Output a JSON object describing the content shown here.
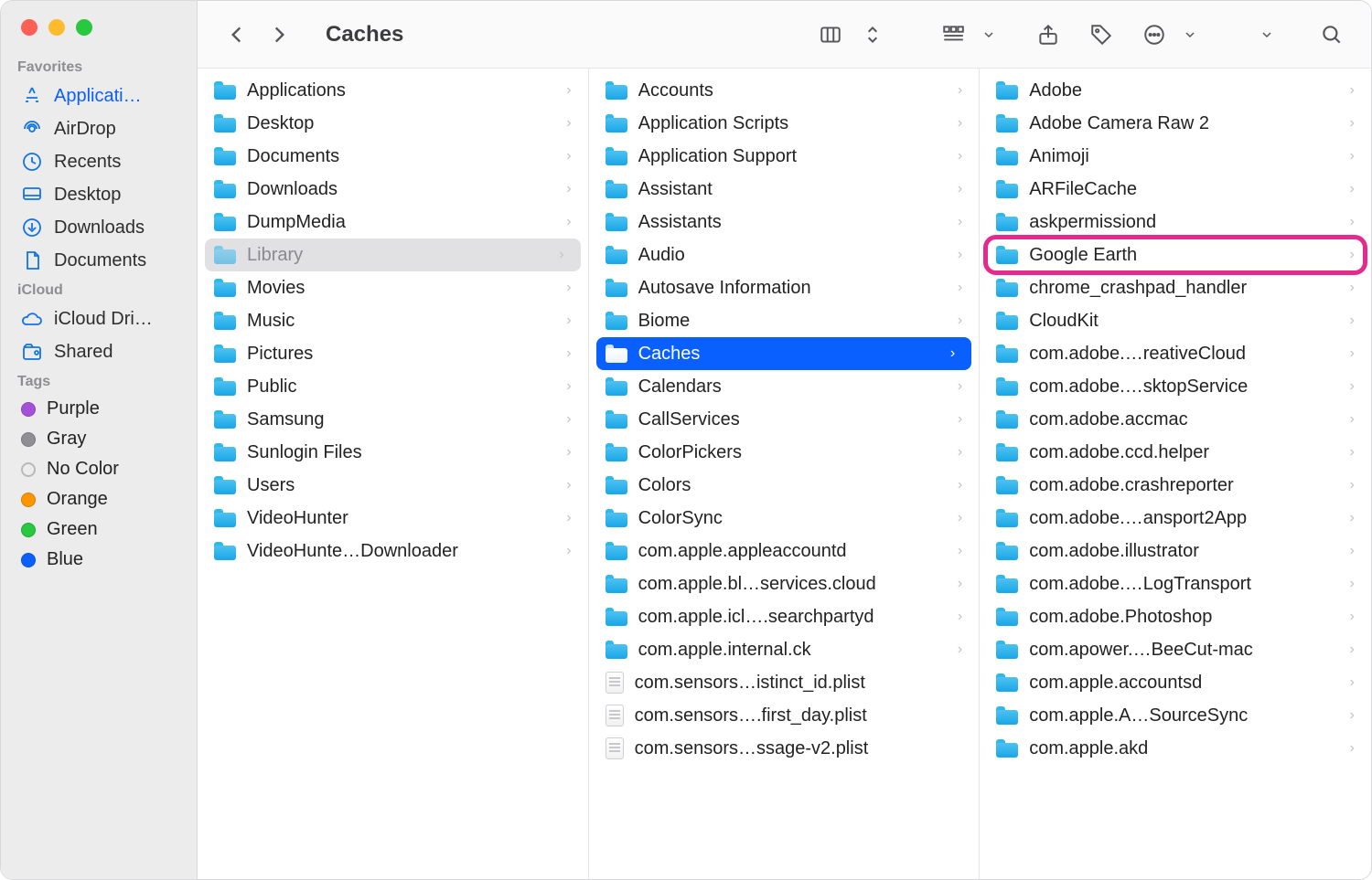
{
  "window_title": "Caches",
  "sidebar": {
    "sections": [
      {
        "heading": "Favorites",
        "items": [
          {
            "icon": "app-store-icon",
            "label": "Applicati…",
            "active": true
          },
          {
            "icon": "airdrop-icon",
            "label": "AirDrop"
          },
          {
            "icon": "recents-icon",
            "label": "Recents"
          },
          {
            "icon": "desktop-icon",
            "label": "Desktop"
          },
          {
            "icon": "downloads-icon",
            "label": "Downloads"
          },
          {
            "icon": "documents-icon",
            "label": "Documents"
          }
        ]
      },
      {
        "heading": "iCloud",
        "items": [
          {
            "icon": "cloud-icon",
            "label": "iCloud Dri…"
          },
          {
            "icon": "shared-icon",
            "label": "Shared"
          }
        ]
      },
      {
        "heading": "Tags",
        "tags": [
          {
            "color": "#a450d8",
            "label": "Purple"
          },
          {
            "color": "#8e8e93",
            "label": "Gray"
          },
          {
            "color": "transparent",
            "label": "No Color",
            "hollow": true
          },
          {
            "color": "#ff9500",
            "label": "Orange"
          },
          {
            "color": "#28c840",
            "label": "Green"
          },
          {
            "color": "#0a60ff",
            "label": "Blue"
          }
        ]
      }
    ]
  },
  "columns": [
    {
      "items": [
        {
          "type": "folder",
          "name": "Applications"
        },
        {
          "type": "folder",
          "name": "Desktop"
        },
        {
          "type": "folder",
          "name": "Documents"
        },
        {
          "type": "folder",
          "name": "Downloads"
        },
        {
          "type": "folder",
          "name": "DumpMedia"
        },
        {
          "type": "folder",
          "name": "Library",
          "selected": "gray"
        },
        {
          "type": "folder",
          "name": "Movies"
        },
        {
          "type": "folder",
          "name": "Music"
        },
        {
          "type": "folder",
          "name": "Pictures"
        },
        {
          "type": "folder",
          "name": "Public"
        },
        {
          "type": "folder",
          "name": "Samsung"
        },
        {
          "type": "folder",
          "name": "Sunlogin Files"
        },
        {
          "type": "folder",
          "name": "Users"
        },
        {
          "type": "folder",
          "name": "VideoHunter"
        },
        {
          "type": "folder",
          "name": "VideoHunte…Downloader"
        }
      ]
    },
    {
      "items": [
        {
          "type": "folder",
          "name": "Accounts"
        },
        {
          "type": "folder",
          "name": "Application Scripts"
        },
        {
          "type": "folder",
          "name": "Application Support"
        },
        {
          "type": "folder",
          "name": "Assistant"
        },
        {
          "type": "folder",
          "name": "Assistants"
        },
        {
          "type": "folder",
          "name": "Audio"
        },
        {
          "type": "folder",
          "name": "Autosave Information"
        },
        {
          "type": "folder",
          "name": "Biome"
        },
        {
          "type": "folder",
          "name": "Caches",
          "selected": "blue"
        },
        {
          "type": "folder",
          "name": "Calendars"
        },
        {
          "type": "folder",
          "name": "CallServices"
        },
        {
          "type": "folder",
          "name": "ColorPickers"
        },
        {
          "type": "folder",
          "name": "Colors"
        },
        {
          "type": "folder",
          "name": "ColorSync"
        },
        {
          "type": "folder",
          "name": "com.apple.appleaccountd"
        },
        {
          "type": "folder",
          "name": "com.apple.bl…services.cloud"
        },
        {
          "type": "folder",
          "name": "com.apple.icl….searchpartyd"
        },
        {
          "type": "folder",
          "name": "com.apple.internal.ck"
        },
        {
          "type": "file",
          "name": "com.sensors…istinct_id.plist"
        },
        {
          "type": "file",
          "name": "com.sensors….first_day.plist"
        },
        {
          "type": "file",
          "name": "com.sensors…ssage-v2.plist"
        }
      ]
    },
    {
      "items": [
        {
          "type": "folder",
          "name": "Adobe"
        },
        {
          "type": "folder",
          "name": "Adobe Camera Raw 2"
        },
        {
          "type": "folder",
          "name": "Animoji"
        },
        {
          "type": "folder",
          "name": "ARFileCache"
        },
        {
          "type": "folder",
          "name": "askpermissiond"
        },
        {
          "type": "folder",
          "name": "Google Earth",
          "highlight": true
        },
        {
          "type": "folder",
          "name": "chrome_crashpad_handler"
        },
        {
          "type": "folder",
          "name": "CloudKit"
        },
        {
          "type": "folder",
          "name": "com.adobe.…reativeCloud"
        },
        {
          "type": "folder",
          "name": "com.adobe.…sktopService"
        },
        {
          "type": "folder",
          "name": "com.adobe.accmac"
        },
        {
          "type": "folder",
          "name": "com.adobe.ccd.helper"
        },
        {
          "type": "folder",
          "name": "com.adobe.crashreporter"
        },
        {
          "type": "folder",
          "name": "com.adobe.…ansport2App"
        },
        {
          "type": "folder",
          "name": "com.adobe.illustrator"
        },
        {
          "type": "folder",
          "name": "com.adobe.…LogTransport"
        },
        {
          "type": "folder",
          "name": "com.adobe.Photoshop"
        },
        {
          "type": "folder",
          "name": "com.apower.…BeeCut-mac"
        },
        {
          "type": "folder",
          "name": "com.apple.accountsd"
        },
        {
          "type": "folder",
          "name": "com.apple.A…SourceSync"
        },
        {
          "type": "folder",
          "name": "com.apple.akd"
        }
      ]
    }
  ]
}
